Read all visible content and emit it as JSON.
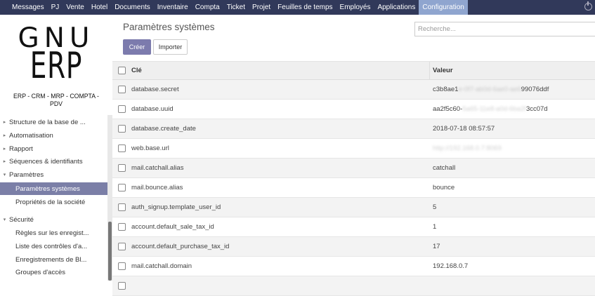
{
  "topbar": {
    "menu": [
      "Messages",
      "PJ",
      "Vente",
      "Hotel",
      "Documents",
      "Inventaire",
      "Compta",
      "Ticket",
      "Projet",
      "Feuilles de temps",
      "Employés",
      "Applications",
      "Configuration"
    ],
    "active": "Configuration"
  },
  "logo": {
    "line1": "GNU",
    "line2": "ERP",
    "tagline": "ERP - CRM - MRP - COMPTA - PDV"
  },
  "sidebar": {
    "items": [
      {
        "label": "Structure de la base de ...",
        "caret": "▸",
        "level": 0
      },
      {
        "label": "Automatisation",
        "caret": "▸",
        "level": 0
      },
      {
        "label": "Rapport",
        "caret": "▸",
        "level": 0
      },
      {
        "label": "Séquences & identifiants",
        "caret": "▸",
        "level": 0
      },
      {
        "label": "Paramètres",
        "caret": "▾",
        "level": 0
      },
      {
        "label": "Paramètres systèmes",
        "caret": "",
        "level": 1,
        "active": true
      },
      {
        "label": "Propriétés de la société",
        "caret": "",
        "level": 1
      },
      {
        "label": "Sécurité",
        "caret": "▾",
        "level": 0
      },
      {
        "label": "Règles sur les enregist...",
        "caret": "",
        "level": 1
      },
      {
        "label": "Liste des contrôles d'a...",
        "caret": "",
        "level": 1
      },
      {
        "label": "Enregistrements de Bl...",
        "caret": "",
        "level": 1
      },
      {
        "label": "Groupes d'accès",
        "caret": "",
        "level": 1
      }
    ]
  },
  "main": {
    "title": "Paramètres systèmes",
    "search_placeholder": "Recherche...",
    "create_label": "Créer",
    "import_label": "Importer",
    "columns": {
      "key": "Clé",
      "value": "Valeur"
    },
    "rows": [
      {
        "key": "database.secret",
        "value_start": "c3b8ae1",
        "value_hidden": "e-0f7-ab0d-6ae0-ae6",
        "value_end": "99076ddf"
      },
      {
        "key": "database.uuid",
        "value_start": "aa2f5c60-",
        "value_hidden": "5a65-11e8-a0d-6ba2f",
        "value_end": "3cc07d"
      },
      {
        "key": "database.create_date",
        "value_start": "2018-07-18 08:57:57",
        "value_hidden": "",
        "value_end": ""
      },
      {
        "key": "web.base.url",
        "value_start": "",
        "value_hidden": "http://192.168.0.7:8069",
        "value_end": ""
      },
      {
        "key": "mail.catchall.alias",
        "value_start": "catchall",
        "value_hidden": "",
        "value_end": ""
      },
      {
        "key": "mail.bounce.alias",
        "value_start": "bounce",
        "value_hidden": "",
        "value_end": ""
      },
      {
        "key": "auth_signup.template_user_id",
        "value_start": "5",
        "value_hidden": "",
        "value_end": ""
      },
      {
        "key": "account.default_sale_tax_id",
        "value_start": "1",
        "value_hidden": "",
        "value_end": ""
      },
      {
        "key": "account.default_purchase_tax_id",
        "value_start": "17",
        "value_hidden": "",
        "value_end": ""
      },
      {
        "key": "mail.catchall.domain",
        "value_start": "192.168.0.7",
        "value_hidden": "",
        "value_end": ""
      }
    ]
  }
}
